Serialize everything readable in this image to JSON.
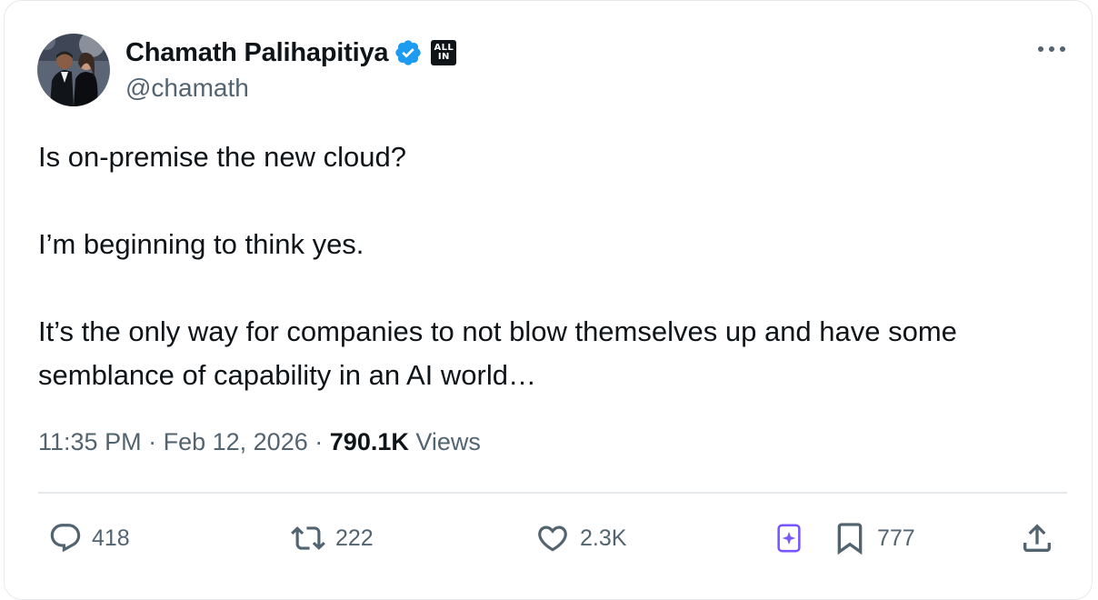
{
  "author": {
    "display_name": "Chamath Palihapitiya",
    "handle": "@chamath",
    "affiliation_badge": {
      "line1": "ALL",
      "line2": "IN"
    },
    "verified_color": "#1d9bf0"
  },
  "tweet": {
    "paragraphs": [
      "Is on-premise the new cloud?",
      "I’m beginning to think yes.",
      "It’s the only way for companies to not blow themselves up and have some semblance of capability in an AI world…"
    ]
  },
  "meta": {
    "time": "11:35 PM",
    "separator": "·",
    "date": "Feb 12, 2026",
    "views_count": "790.1K",
    "views_label": "Views"
  },
  "actions": {
    "replies": "418",
    "reposts": "222",
    "likes": "2.3K",
    "bookmarks": "777"
  },
  "icons": {
    "more": "more-horizontal-icon",
    "reply": "reply-icon",
    "repost": "repost-icon",
    "like": "heart-icon",
    "grok": "grok-bookmark-icon",
    "bookmark": "bookmark-icon",
    "share": "share-icon"
  },
  "colors": {
    "text_primary": "#0f1419",
    "text_secondary": "#536471",
    "accent_purple": "#7856ff",
    "border": "#e6e9ec"
  }
}
